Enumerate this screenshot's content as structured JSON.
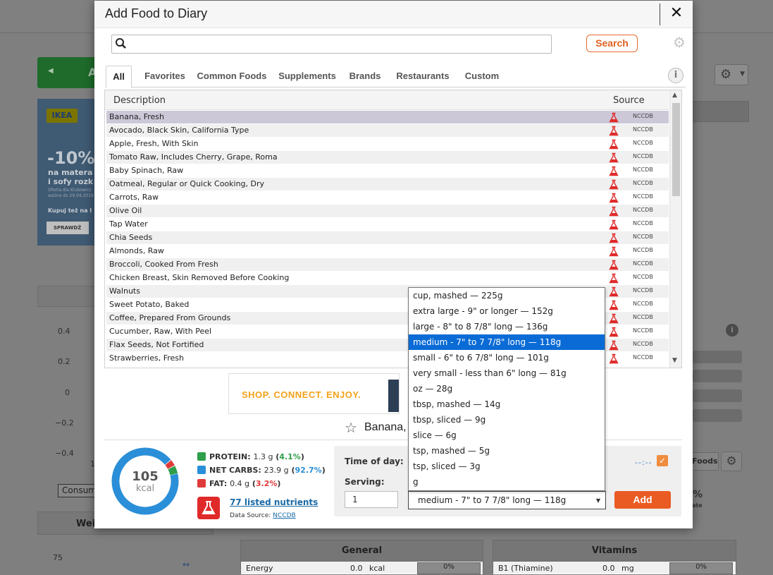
{
  "background": {
    "ikea": {
      "logo": "IKEA",
      "discount": "-10%",
      "line1": "na matera",
      "line2": "i sofy rozk",
      "fine1": "Oferta dla Klubowicz",
      "fine2": "ważna do 29.04.2019",
      "buy": "Kupuj też na I",
      "button": "SPRAWDŹ"
    },
    "chart_ticks": [
      "0.4",
      "0.2",
      "0",
      "−0.2",
      "−0.4"
    ],
    "tick_one": "1",
    "consume_select": "Consum",
    "weight_title": "Weig",
    "weight_tick": "75",
    "foods_btn": "Foods",
    "pct_text": "%",
    "ate_text": "ate",
    "general": {
      "title": "General",
      "row_label": "Energy",
      "row_value": "0.0",
      "row_unit": "kcal",
      "row_pct": "0%"
    },
    "vitamins": {
      "title": "Vitamins",
      "row_label": "B1 (Thiamine)",
      "row_value": "0.0",
      "row_unit": "mg",
      "row_pct": "0%"
    }
  },
  "modal": {
    "title": "Add Food to Diary",
    "close_icon": "close-icon",
    "search": {
      "placeholder": "",
      "value": "",
      "button": "Search"
    },
    "tabs": [
      "All",
      "Favorites",
      "Common Foods",
      "Supplements",
      "Brands",
      "Restaurants",
      "Custom"
    ],
    "active_tab": "All",
    "columns": {
      "description": "Description",
      "source": "Source"
    },
    "foods": [
      {
        "name": "Banana, Fresh",
        "source": "NCCDB"
      },
      {
        "name": "Avocado, Black Skin, California Type",
        "source": "NCCDB"
      },
      {
        "name": "Apple, Fresh, With Skin",
        "source": "NCCDB"
      },
      {
        "name": "Tomato Raw, Includes Cherry, Grape, Roma",
        "source": "NCCDB"
      },
      {
        "name": "Baby Spinach, Raw",
        "source": "NCCDB"
      },
      {
        "name": "Oatmeal, Regular or Quick Cooking, Dry",
        "source": "NCCDB"
      },
      {
        "name": "Carrots, Raw",
        "source": "NCCDB"
      },
      {
        "name": "Olive Oil",
        "source": "NCCDB"
      },
      {
        "name": "Tap Water",
        "source": "NCCDB"
      },
      {
        "name": "Chia Seeds",
        "source": "NCCDB"
      },
      {
        "name": "Almonds, Raw",
        "source": "NCCDB"
      },
      {
        "name": "Broccoli, Cooked From Fresh",
        "source": "NCCDB"
      },
      {
        "name": "Chicken Breast, Skin Removed Before Cooking",
        "source": "NCCDB"
      },
      {
        "name": "Walnuts",
        "source": "NCCDB"
      },
      {
        "name": "Sweet Potato, Baked",
        "source": "NCCDB"
      },
      {
        "name": "Coffee, Prepared From Grounds",
        "source": "NCCDB"
      },
      {
        "name": "Cucumber, Raw, With Peel",
        "source": "NCCDB"
      },
      {
        "name": "Flax Seeds, Not Fortified",
        "source": "NCCDB"
      },
      {
        "name": "Strawberries, Fresh",
        "source": "NCCDB"
      }
    ],
    "selected_food_index": 0,
    "ad_text": "SHOP.   CONNECT.   ENJOY.",
    "food_title": "Banana,",
    "kcal_value": "105",
    "kcal_unit": "kcal",
    "macros": [
      {
        "label": "PROTEIN:",
        "value": "1.3 g",
        "pct": "4.1%",
        "color": "#2e9e4a",
        "pct_color": "#2e9e4a",
        "fraction": 0.041
      },
      {
        "label": "NET CARBS:",
        "value": "23.9 g",
        "pct": "92.7%",
        "color": "#2a8fd8",
        "pct_color": "#2a8fd8",
        "fraction": 0.927
      },
      {
        "label": "FAT:",
        "value": "0.4 g",
        "pct": "3.2%",
        "color": "#e03a3a",
        "pct_color": "#e03a3a",
        "fraction": 0.032
      }
    ],
    "nutrients_link": "77 listed nutrients",
    "data_source_label": "Data Source:",
    "data_source": "NCCDB",
    "time_of_day_label": "Time of day:",
    "time_value": "--:--",
    "serving_label": "Serving:",
    "quantity": "1",
    "serving_selected": "medium - 7\" to 7 7/8\" long — 118g",
    "serving_options": [
      "cup, mashed — 225g",
      "extra large - 9\" or longer — 152g",
      "large - 8\" to 8 7/8\" long — 136g",
      "medium - 7\" to 7 7/8\" long — 118g",
      "small - 6\" to 6 7/8\" long — 101g",
      "very small - less than 6\" long — 81g",
      "oz — 28g",
      "tbsp, mashed — 14g",
      "tbsp, sliced — 9g",
      "slice — 6g",
      "tsp, mashed — 5g",
      "tsp, sliced — 3g",
      "g"
    ],
    "serving_selected_index": 3,
    "add_button": "Add",
    "accent_color": "#ea5b23"
  }
}
